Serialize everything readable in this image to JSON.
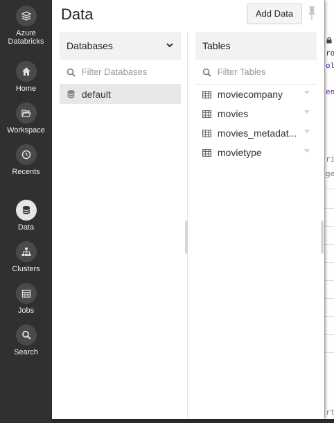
{
  "nav": {
    "brand_line1": "Azure",
    "brand_line2": "Databricks",
    "items": [
      {
        "label": "Home"
      },
      {
        "label": "Workspace"
      },
      {
        "label": "Recents"
      },
      {
        "label": "Data"
      },
      {
        "label": "Clusters"
      },
      {
        "label": "Jobs"
      },
      {
        "label": "Search"
      }
    ]
  },
  "panel": {
    "title": "Data",
    "add_label": "Add Data"
  },
  "databases": {
    "header": "Databases",
    "filter_placeholder": "Filter Databases",
    "items": [
      "default"
    ]
  },
  "tables": {
    "header": "Tables",
    "filter_placeholder": "Filter Tables",
    "items": [
      "moviecompany",
      "movies",
      "movies_metadat...",
      "movietype"
    ]
  },
  "background": {
    "snippets": [
      "ron",
      "olo",
      "enn",
      "ring",
      "ge"
    ],
    "bottom_snippet": "rt"
  },
  "colors": {
    "nav_bg": "#303030",
    "panel_bg": "#ffffff",
    "selected_row": "#e8e8e8"
  }
}
